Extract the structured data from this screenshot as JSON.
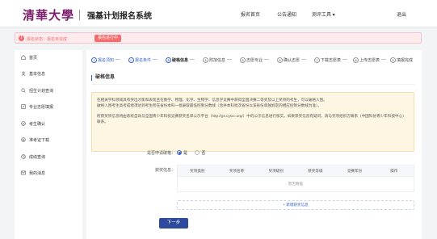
{
  "header": {
    "logo_text": "清華大學",
    "system_title": "强基计划报名系统",
    "nav": [
      "报名首页",
      "公告通知",
      "测评工具 ▾",
      "退出"
    ]
  },
  "status": {
    "icon": "exclamation-icon",
    "text": "报名状态：报名未完成",
    "badge": "报名进行中"
  },
  "sidebar": {
    "items": [
      {
        "label": "首页",
        "icon": "home-icon"
      },
      {
        "label": "基本信息",
        "icon": "user-icon"
      },
      {
        "label": "招生计划查询",
        "icon": "search-icon"
      },
      {
        "label": "专业志愿填报",
        "icon": "edit-icon"
      },
      {
        "label": "考生确认",
        "icon": "check-icon"
      },
      {
        "label": "准考证下载",
        "icon": "download-icon"
      },
      {
        "label": "成绩查询",
        "icon": "chart-icon"
      },
      {
        "label": "我的消息",
        "icon": "message-icon"
      }
    ]
  },
  "steps": [
    {
      "num": "1",
      "label": "报名须知",
      "state": "done"
    },
    {
      "num": "2",
      "label": "报名条件",
      "state": "done"
    },
    {
      "num": "3",
      "label": "破格信息",
      "state": "active"
    },
    {
      "num": "4",
      "label": "附加信息",
      "state": "todo"
    },
    {
      "num": "5",
      "label": "志愿专业",
      "state": "todo"
    },
    {
      "num": "6",
      "label": "确认志愿",
      "state": "todo"
    },
    {
      "num": "7",
      "label": "下载志愿表",
      "state": "todo"
    },
    {
      "num": "8",
      "label": "上传志愿表",
      "state": "todo"
    },
    {
      "num": "9",
      "label": "填报完成",
      "state": "todo"
    }
  ],
  "section_title": "破格信息",
  "notice": {
    "line1": "在相关学科领域具有突出才能和表现且在数学、物理、化学、生物学、信息学竞赛中获得全国决赛二等奖及以上奖项的考生，可以破格入围。",
    "line2": "破格入围考生高考成绩须达到考生所在省份本科一批录取最低控制分数线（合并本科批次省份以该省份单独划定的相应控制分数线为准）。",
    "line3": "所获奖项信息将由系统自动与全国青少年科技竞赛获奖名单公示平台（http://gs.cyscc.org/）中的公示信息进行核实。如果获奖信息有疑问，请与奖项组织方联系（中国科协青少年科技中心）联系。"
  },
  "form": {
    "has_award_label": "是否申请破格：",
    "yes_label": "是",
    "no_label": "否",
    "award_info_label": "获奖信息："
  },
  "table": {
    "columns": [
      "奖项类别",
      "奖项名称",
      "奖项级别",
      "获奖等级",
      "竞赛年份",
      "操作"
    ],
    "empty_text": "暂无数据"
  },
  "add_button": "+ 新增获奖信息",
  "next_button": "下一步"
}
